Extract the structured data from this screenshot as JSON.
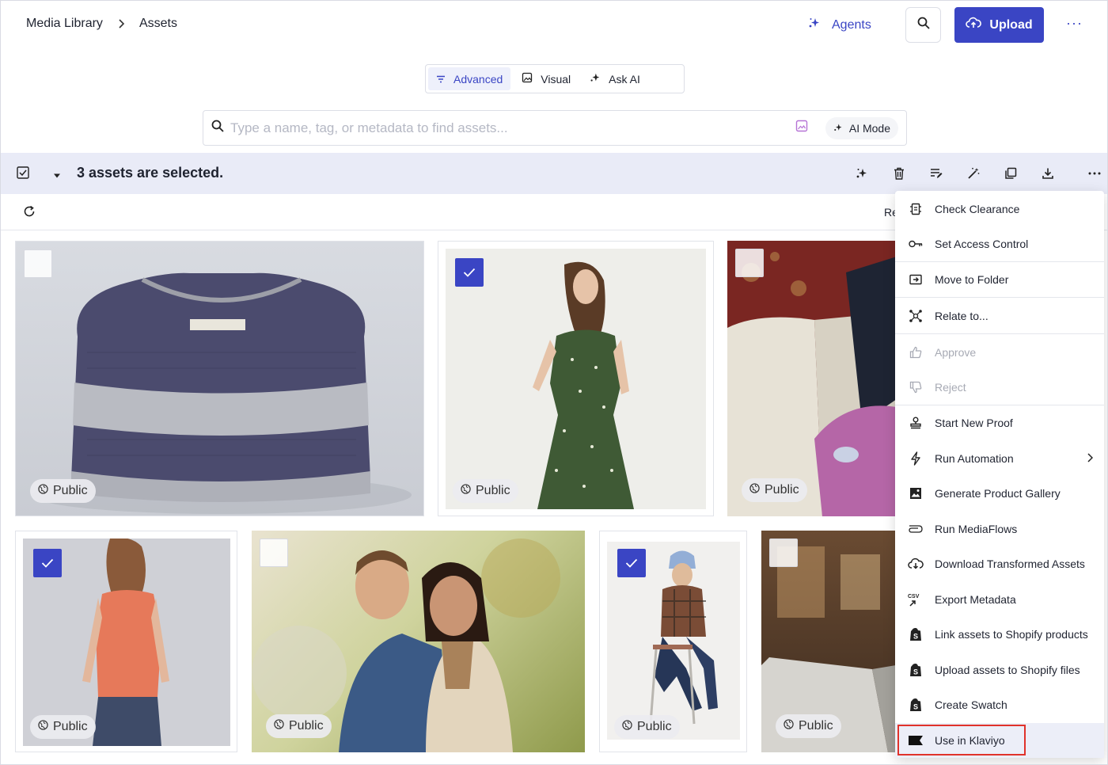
{
  "header": {
    "breadcrumb": [
      "Media Library",
      "Assets"
    ],
    "agents_label": "Agents",
    "upload_label": "Upload",
    "more": "···"
  },
  "modes": [
    {
      "label": "Advanced",
      "active": true
    },
    {
      "label": "Visual",
      "active": false
    },
    {
      "label": "Ask AI",
      "active": false
    }
  ],
  "search": {
    "placeholder": "Type a name, tag, or metadata to find assets...",
    "ai_mode_label": "AI Mode"
  },
  "selection": {
    "count_text": "3 assets are selected."
  },
  "toolbar": {
    "partial_text": "Re"
  },
  "assets": [
    {
      "subject": "knit sweater",
      "visibility": "Public",
      "checked": false
    },
    {
      "subject": "green polka dot dress",
      "visibility": "Public",
      "checked": true
    },
    {
      "subject": "sofa lounging",
      "visibility": "Public",
      "checked": false
    },
    {
      "subject": "orange tank top",
      "visibility": "Public",
      "checked": true
    },
    {
      "subject": "couple embracing",
      "visibility": "Public",
      "checked": false
    },
    {
      "subject": "plaid shirt beanie",
      "visibility": "Public",
      "checked": true
    },
    {
      "subject": "laptop cafe",
      "visibility": "Public",
      "checked": false
    }
  ],
  "menu": [
    {
      "label": "Check Clearance",
      "icon": "clearance-icon",
      "disabled": false
    },
    {
      "label": "Set Access Control",
      "icon": "key-icon",
      "disabled": false
    },
    {
      "label": "Move to Folder",
      "icon": "folder-move-icon",
      "disabled": false
    },
    {
      "label": "Relate to...",
      "icon": "relate-icon",
      "disabled": false
    },
    {
      "label": "Approve",
      "icon": "thumbs-up-icon",
      "disabled": true
    },
    {
      "label": "Reject",
      "icon": "thumbs-down-icon",
      "disabled": true
    },
    {
      "label": "Start New Proof",
      "icon": "stamp-icon",
      "disabled": false
    },
    {
      "label": "Run Automation",
      "icon": "lightning-icon",
      "disabled": false
    },
    {
      "label": "Generate Product Gallery",
      "icon": "gallery-icon",
      "disabled": false
    },
    {
      "label": "Run MediaFlows",
      "icon": "mediaflows-icon",
      "disabled": false
    },
    {
      "label": "Download Transformed Assets",
      "icon": "cloud-download-icon",
      "disabled": false
    },
    {
      "label": "Export Metadata",
      "icon": "csv-export-icon",
      "disabled": false
    },
    {
      "label": "Link assets to Shopify products",
      "icon": "shopify-icon",
      "disabled": false
    },
    {
      "label": "Upload assets to Shopify files",
      "icon": "shopify-icon",
      "disabled": false
    },
    {
      "label": "Create Swatch",
      "icon": "shopify-icon",
      "disabled": false
    },
    {
      "label": "Use in Klaviyo",
      "icon": "klaviyo-icon",
      "disabled": false
    }
  ],
  "colors": {
    "accent": "#3a45c4",
    "highlight_border": "#e0322b",
    "selection_bar": "#e9ebf7"
  }
}
